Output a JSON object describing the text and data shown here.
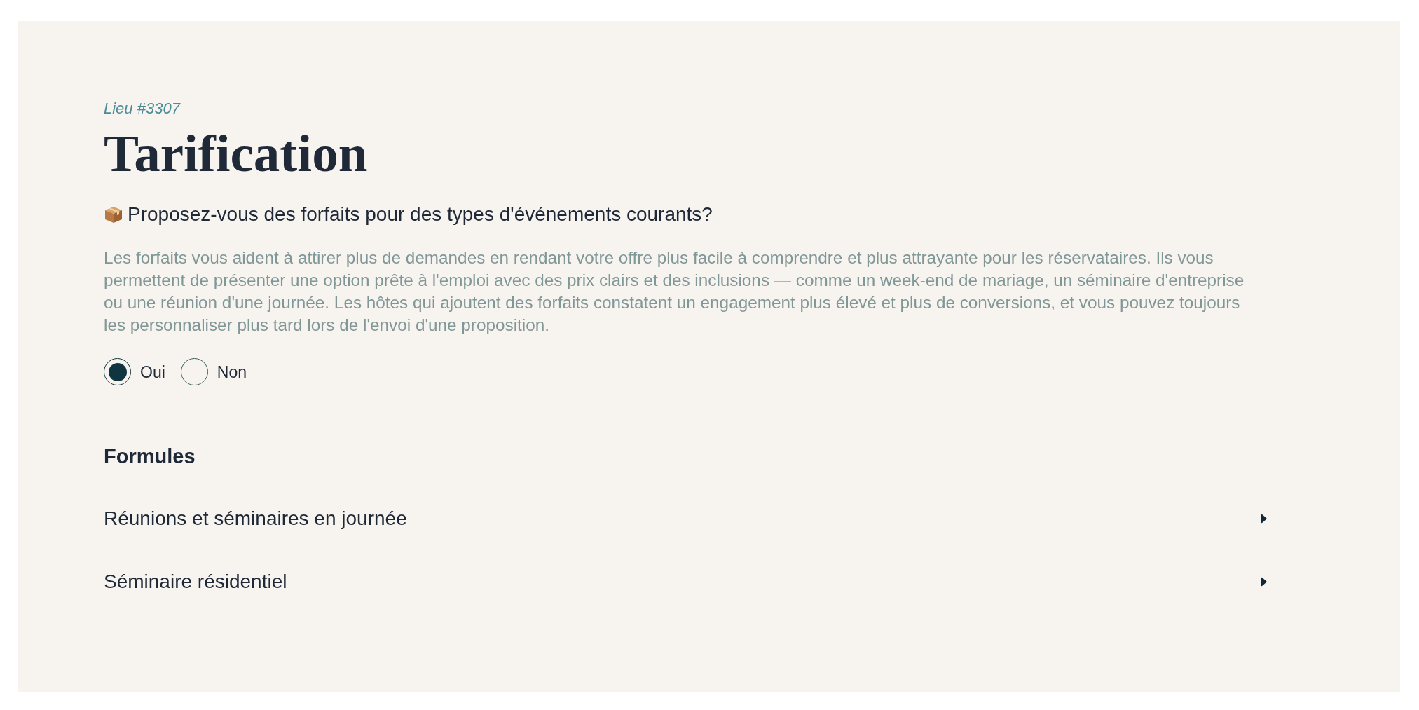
{
  "venue_label": "Lieu #3307",
  "title": "Tarification",
  "question": {
    "text": "Proposez-vous des forfaits pour des types d'événements courants?",
    "description": "Les forfaits vous aident à attirer plus de demandes en rendant votre offre plus facile à comprendre et plus attrayante pour les réservataires. Ils vous permettent de présenter une option prête à l'emploi avec des prix clairs et des inclusions — comme un week-end de mariage, un séminaire d'entreprise ou une réunion d'une journée. Les hôtes qui ajoutent des forfaits constatent un engagement plus élevé et plus de conversions, et vous pouvez toujours les personnaliser plus tard lors de l'envoi d'une proposition.",
    "options": [
      {
        "label": "Oui",
        "selected": true
      },
      {
        "label": "Non",
        "selected": false
      }
    ]
  },
  "packages": {
    "heading": "Formules",
    "items": [
      {
        "label": "Réunions et séminaires en journée",
        "expanded": false
      },
      {
        "label": "Séminaire résidentiel",
        "expanded": false
      }
    ]
  }
}
